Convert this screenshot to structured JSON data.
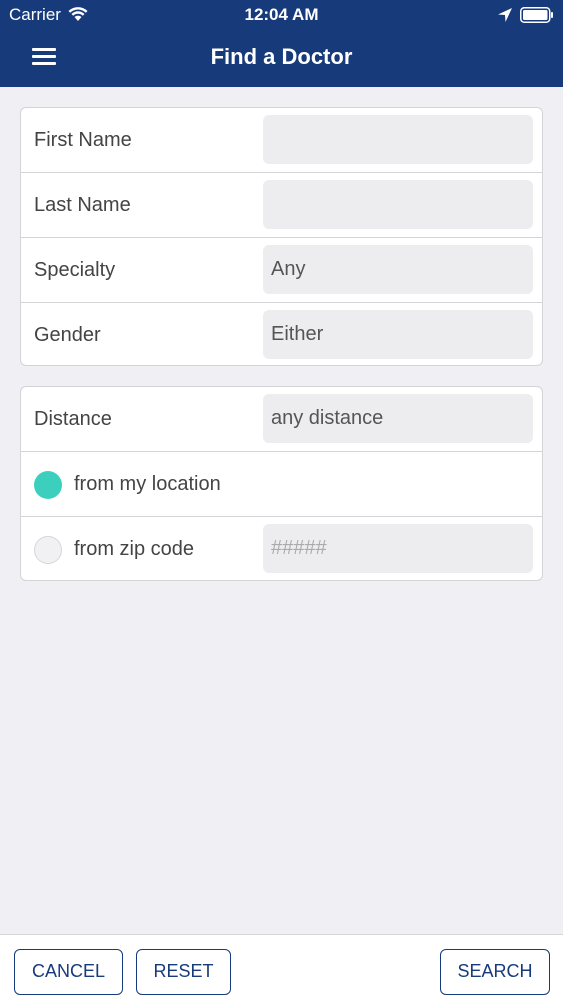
{
  "status_bar": {
    "carrier": "Carrier",
    "time": "12:04 AM"
  },
  "nav": {
    "title": "Find a Doctor",
    "menu_icon": "hamburger-menu-icon"
  },
  "search_form": {
    "first_name": {
      "label": "First Name",
      "value": ""
    },
    "last_name": {
      "label": "Last Name",
      "value": ""
    },
    "specialty": {
      "label": "Specialty",
      "value": "Any"
    },
    "gender": {
      "label": "Gender",
      "value": "Either"
    }
  },
  "location_form": {
    "distance": {
      "label": "Distance",
      "value": "any distance"
    },
    "from_my_location": {
      "label": "from my location",
      "selected": true
    },
    "from_zip_code": {
      "label": "from zip code",
      "selected": false,
      "placeholder": "#####"
    }
  },
  "footer": {
    "cancel_label": "CANCEL",
    "reset_label": "RESET",
    "search_label": "SEARCH"
  },
  "colors": {
    "header": "#173a7a",
    "accent_radio": "#3dcfbe",
    "background": "#efeff4"
  }
}
